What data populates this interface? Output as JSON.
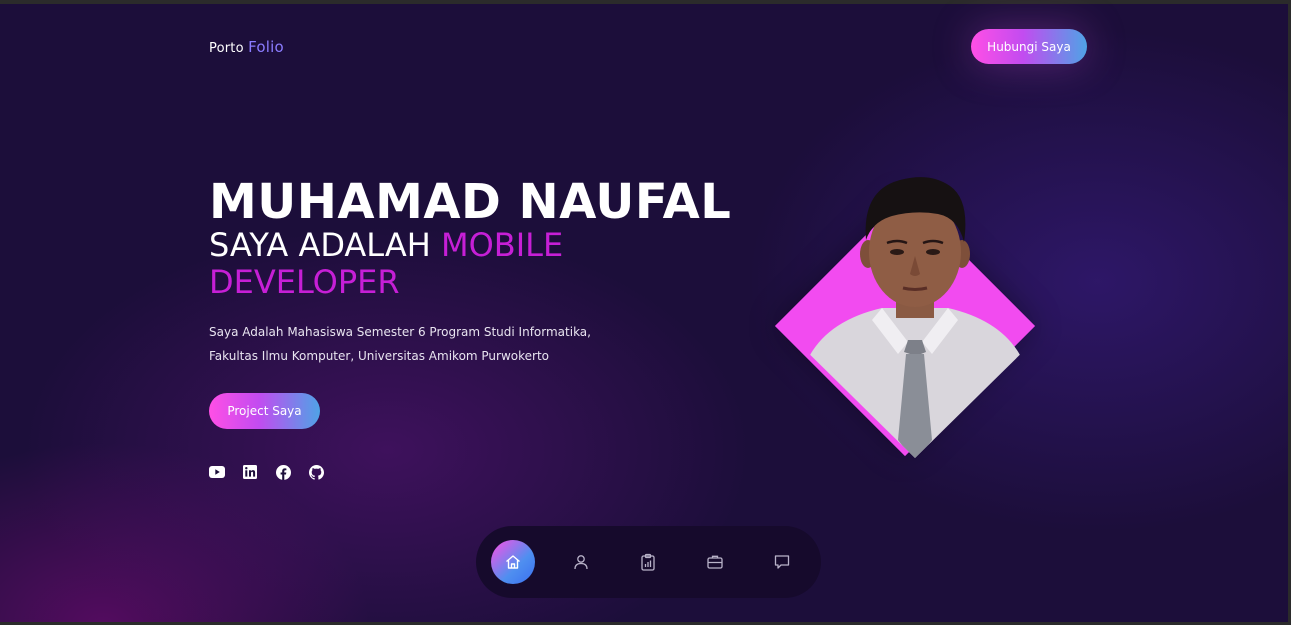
{
  "header": {
    "logo_prefix": "Porto",
    "logo_accent": "Folio",
    "contact_button": "Hubungi Saya"
  },
  "hero": {
    "name": "MUHAMAD NAUFAL",
    "role_prefix": "SAYA ADALAH",
    "role_highlight": "MOBILE DEVELOPER",
    "description_line1": "Saya Adalah Mahasiswa Semester 6 Program Studi Informatika,",
    "description_line2": "Fakultas Ilmu Komputer, Universitas Amikom Purwokerto",
    "project_button": "Project Saya"
  },
  "socials": [
    "youtube-icon",
    "linkedin-icon",
    "facebook-icon",
    "github-icon"
  ],
  "dock": {
    "items": [
      "home-icon",
      "user-icon",
      "clipboard-chart-icon",
      "briefcase-icon",
      "message-icon"
    ],
    "active": "home-icon"
  },
  "colors": {
    "background": "#1c0e3a",
    "accent_pink": "#ff4fe6",
    "accent_blue": "#4fa3e6",
    "highlight_text": "#c61fd6",
    "diamond": "#f24bf0",
    "logo_accent": "#8b7cff"
  }
}
